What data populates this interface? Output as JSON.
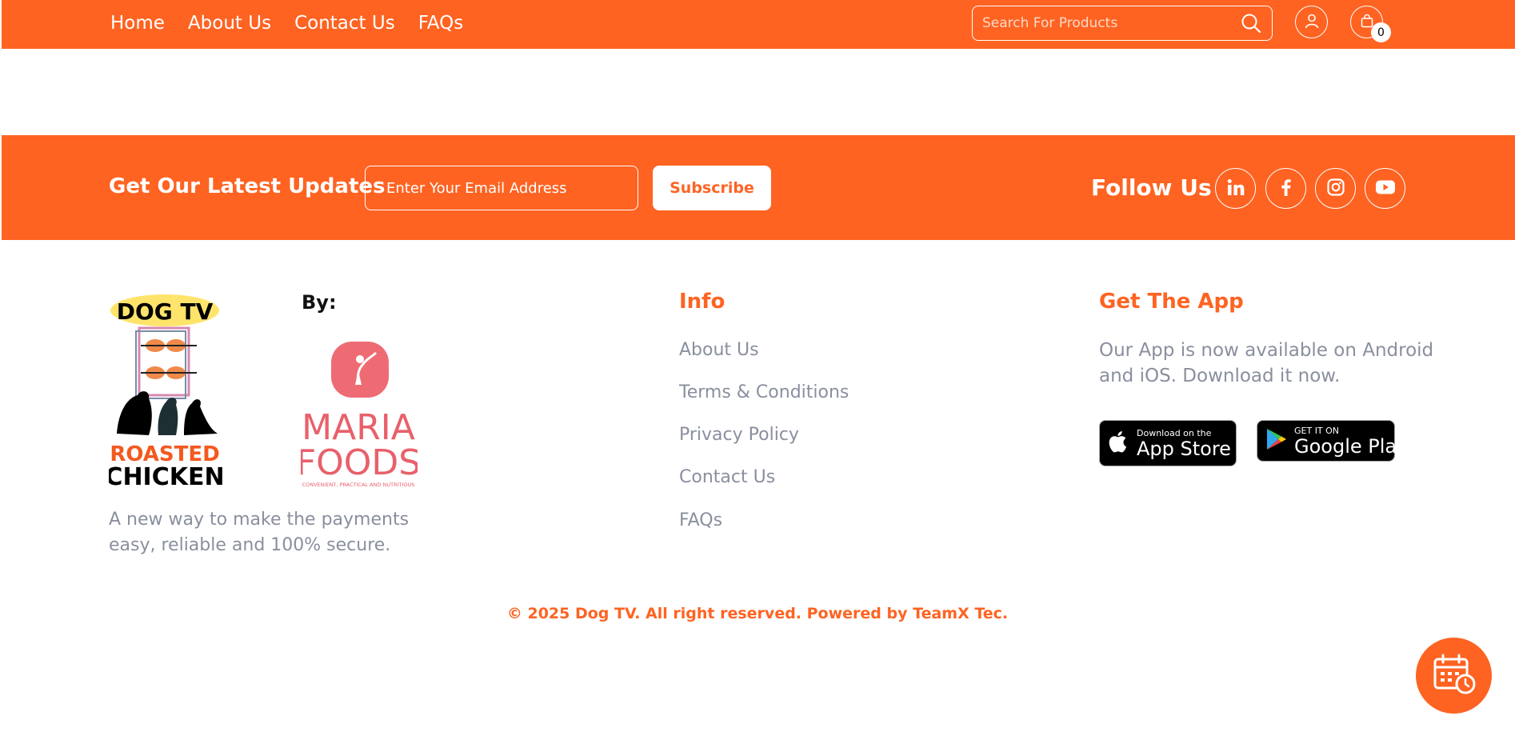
{
  "nav": {
    "links": [
      "Home",
      "About Us",
      "Contact Us",
      "FAQs"
    ],
    "search_placeholder": "Search For Products",
    "cart_count": "0"
  },
  "updates": {
    "title": "Get Our Latest Updates",
    "email_placeholder": "Enter Your Email Address",
    "subscribe_label": "Subscribe",
    "follow_title": "Follow Us",
    "social_icons": [
      "linkedin-icon",
      "facebook-icon",
      "instagram-icon",
      "youtube-icon"
    ]
  },
  "brand": {
    "logo_text_top": "DOG TV",
    "logo_text_mid": "ROASTED",
    "logo_text_bottom": "CHICKEN",
    "by_label": "By:",
    "partner_line1": "MARIA",
    "partner_line2": "FOODS",
    "partner_tag": "CONVENIENT, PRACTICAL AND NUTRITIOUS",
    "tagline": "A new way to make the payments easy, reliable and 100% secure."
  },
  "info": {
    "title": "Info",
    "links": [
      "About Us",
      "Terms & Conditions",
      "Privacy Policy",
      "Contact Us",
      "FAQs"
    ]
  },
  "app": {
    "title": "Get The App",
    "text": "Our App is now available on Android and iOS. Download it now.",
    "apple_small": "Download on the",
    "apple_big": "App Store",
    "google_small": "GET IT ON",
    "google_big": "Google Play"
  },
  "footer": {
    "copyright": "© 2025 Dog TV. All right reserved. Powered by TeamX Tec."
  },
  "colors": {
    "accent": "#fe6322",
    "muted_text": "#8a8f9e",
    "partner_pink": "#e8606b"
  }
}
